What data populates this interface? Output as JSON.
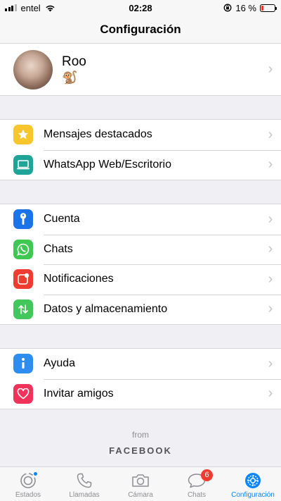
{
  "status_bar": {
    "carrier": "entel",
    "time": "02:28",
    "battery": "16 %",
    "battery_level": 0.16
  },
  "nav": {
    "title": "Configuración"
  },
  "profile": {
    "name": "Roo",
    "status": "🐒"
  },
  "groups": [
    [
      {
        "label": "Mensajes destacados",
        "icon": "star-icon",
        "color": "#f8c52c"
      },
      {
        "label": "WhatsApp Web/Escritorio",
        "icon": "laptop-icon",
        "color": "#1fa597"
      }
    ],
    [
      {
        "label": "Cuenta",
        "icon": "key-icon",
        "color": "#1a73e8"
      },
      {
        "label": "Chats",
        "icon": "whatsapp-icon",
        "color": "#3ec852"
      },
      {
        "label": "Notificaciones",
        "icon": "notification-icon",
        "color": "#f03b30"
      },
      {
        "label": "Datos y almacenamiento",
        "icon": "arrows-icon",
        "color": "#42c75a"
      }
    ],
    [
      {
        "label": "Ayuda",
        "icon": "info-icon",
        "color": "#2e8df0"
      },
      {
        "label": "Invitar amigos",
        "icon": "heart-icon",
        "color": "#f0335a"
      }
    ]
  ],
  "footer": {
    "from": "from",
    "brand": "FACEBOOK"
  },
  "tabs": [
    {
      "label": "Estados",
      "icon": "status-icon"
    },
    {
      "label": "Llamadas",
      "icon": "phone-icon"
    },
    {
      "label": "Cámara",
      "icon": "camera-icon"
    },
    {
      "label": "Chats",
      "icon": "chat-bubble-icon",
      "badge": "6"
    },
    {
      "label": "Configuración",
      "icon": "gear-icon",
      "active": true
    }
  ]
}
